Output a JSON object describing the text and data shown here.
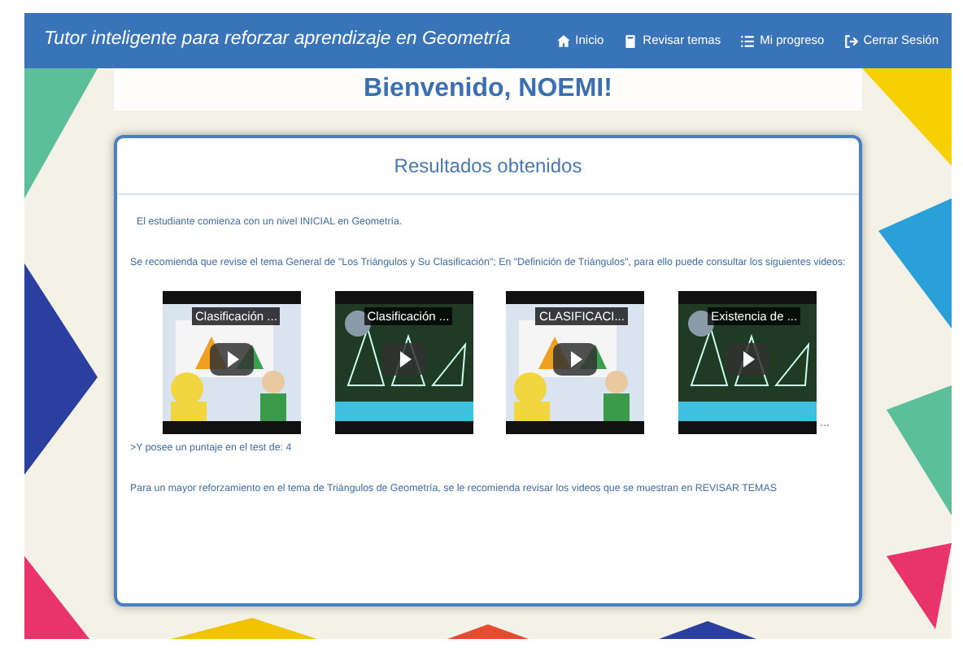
{
  "navbar": {
    "title": "Tutor inteligente para reforzar aprendizaje en Geometría",
    "links": [
      {
        "label": "Inicio"
      },
      {
        "label": "Revisar temas"
      },
      {
        "label": "Mi progreso"
      },
      {
        "label": "Cerrar Sesión"
      }
    ]
  },
  "welcome": "Bienvenido, NOEMI!",
  "card": {
    "title": "Resultados obtenidos",
    "level_text": "El estudiante comienza con un nivel INICIAL en Geometría.",
    "recommendation": "Se recomienda que revise el tema General de \"Los Triángulos y Su Clasificación\"; En \"Definición de Triángulos\", para ello puede consultar los siguientes videos:",
    "videos": [
      {
        "title": "Clasificación ..."
      },
      {
        "title": "Clasificación ..."
      },
      {
        "title": "CLASIFICACI..."
      },
      {
        "title": "Existencia de ..."
      }
    ],
    "more": "...",
    "score_text": ">Y posee un puntaje en el test de: 4",
    "final_text": "Para un mayor reforzamiento en el tema de Triángulos de Geometría, se le recomienda revisar los videos que se muestran en REVISAR TEMAS"
  }
}
